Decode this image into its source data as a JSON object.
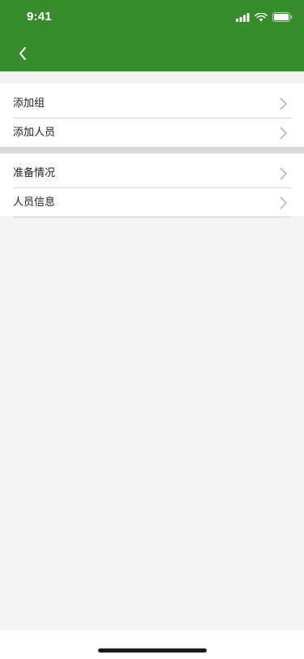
{
  "status_bar": {
    "time": "9:41"
  },
  "nav": {
    "back_icon": "chevron-left-icon"
  },
  "menu": {
    "group1": [
      {
        "label": "添加组"
      },
      {
        "label": "添加人员"
      }
    ],
    "group2": [
      {
        "label": "准备情况"
      },
      {
        "label": "人员信息"
      }
    ]
  },
  "colors": {
    "header": "#368c2a",
    "background": "#f4f4f4",
    "separator": "#d9d9d9"
  }
}
